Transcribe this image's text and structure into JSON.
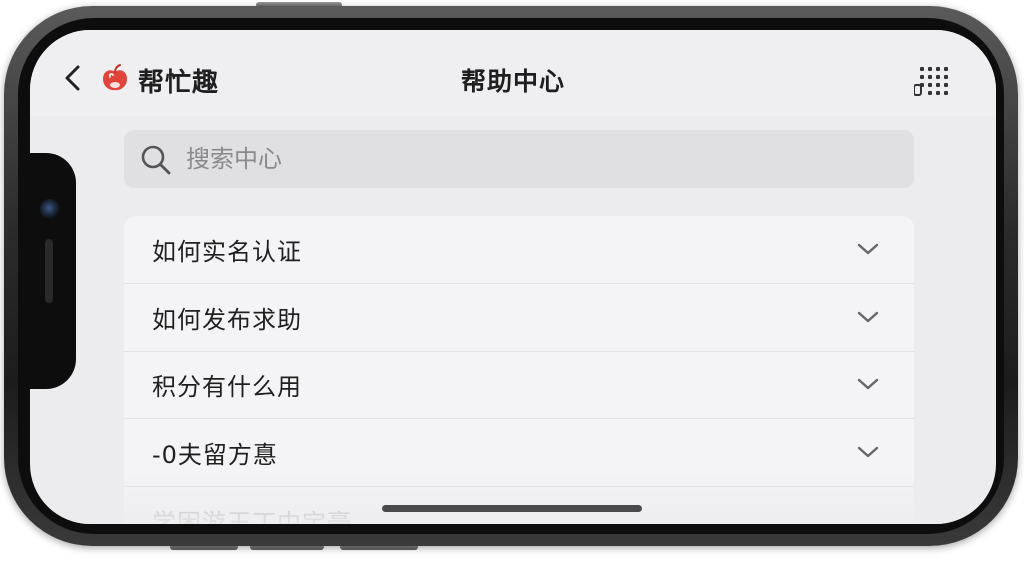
{
  "header": {
    "app_name": "帮忙趣",
    "title": "帮助中心"
  },
  "search": {
    "placeholder": "搜索中心"
  },
  "faq": {
    "items": [
      {
        "label": "如何实名认证"
      },
      {
        "label": "如何发布求助"
      },
      {
        "label": "积分有什么用"
      },
      {
        "label": "-0夫留方惪"
      },
      {
        "label": "学困游玉丁中宝豪"
      }
    ]
  },
  "icons": {
    "back": "chevron-left-icon",
    "logo": "apple-logo-icon",
    "menu": "grid-menu-icon",
    "search": "search-icon",
    "expand": "chevron-down-icon"
  },
  "colors": {
    "logo_red": "#e0443a",
    "text": "#1f1f1f",
    "placeholder": "#8a8a8c",
    "screen_bg": "#ececee",
    "card_bg": "#f4f4f6"
  }
}
